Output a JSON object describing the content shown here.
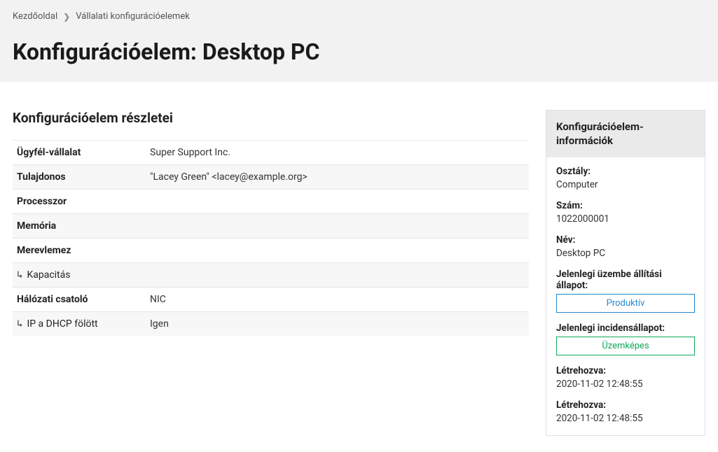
{
  "breadcrumb": {
    "home": "Kezdőoldal",
    "current": "Vállalati konfigurációelemek"
  },
  "page_title": "Konfigurációelem: Desktop PC",
  "details": {
    "section_title": "Konfigurációelem részletei",
    "rows": [
      {
        "label": "Ügyfél-vállalat",
        "value": "Super Support Inc.",
        "indent": false
      },
      {
        "label": "Tulajdonos",
        "value": "\"Lacey Green\" <lacey@example.org>",
        "indent": false
      },
      {
        "label": "Processzor",
        "value": "",
        "indent": false
      },
      {
        "label": "Memória",
        "value": "",
        "indent": false
      },
      {
        "label": "Merevlemez",
        "value": "",
        "indent": false
      },
      {
        "label": "Kapacitás",
        "value": "",
        "indent": true
      },
      {
        "label": "Hálózati csatoló",
        "value": "NIC",
        "indent": false
      },
      {
        "label": "IP a DHCP fölött",
        "value": "Igen",
        "indent": true
      }
    ]
  },
  "sidebar": {
    "header": "Konfigurációelem-információk",
    "items": [
      {
        "label": "Osztály:",
        "value": "Computer",
        "type": "text"
      },
      {
        "label": "Szám:",
        "value": "1022000001",
        "type": "text"
      },
      {
        "label": "Név:",
        "value": "Desktop PC",
        "type": "text"
      },
      {
        "label": "Jelenlegi üzembe állítási állapot:",
        "value": "Produktív",
        "type": "badge",
        "color": "blue"
      },
      {
        "label": "Jelenlegi incidensállapot:",
        "value": "Üzemképes",
        "type": "badge",
        "color": "green"
      },
      {
        "label": "Létrehozva:",
        "value": "2020-11-02 12:48:55",
        "type": "text"
      },
      {
        "label": "Létrehozva:",
        "value": "2020-11-02 12:48:55",
        "type": "text"
      }
    ]
  }
}
